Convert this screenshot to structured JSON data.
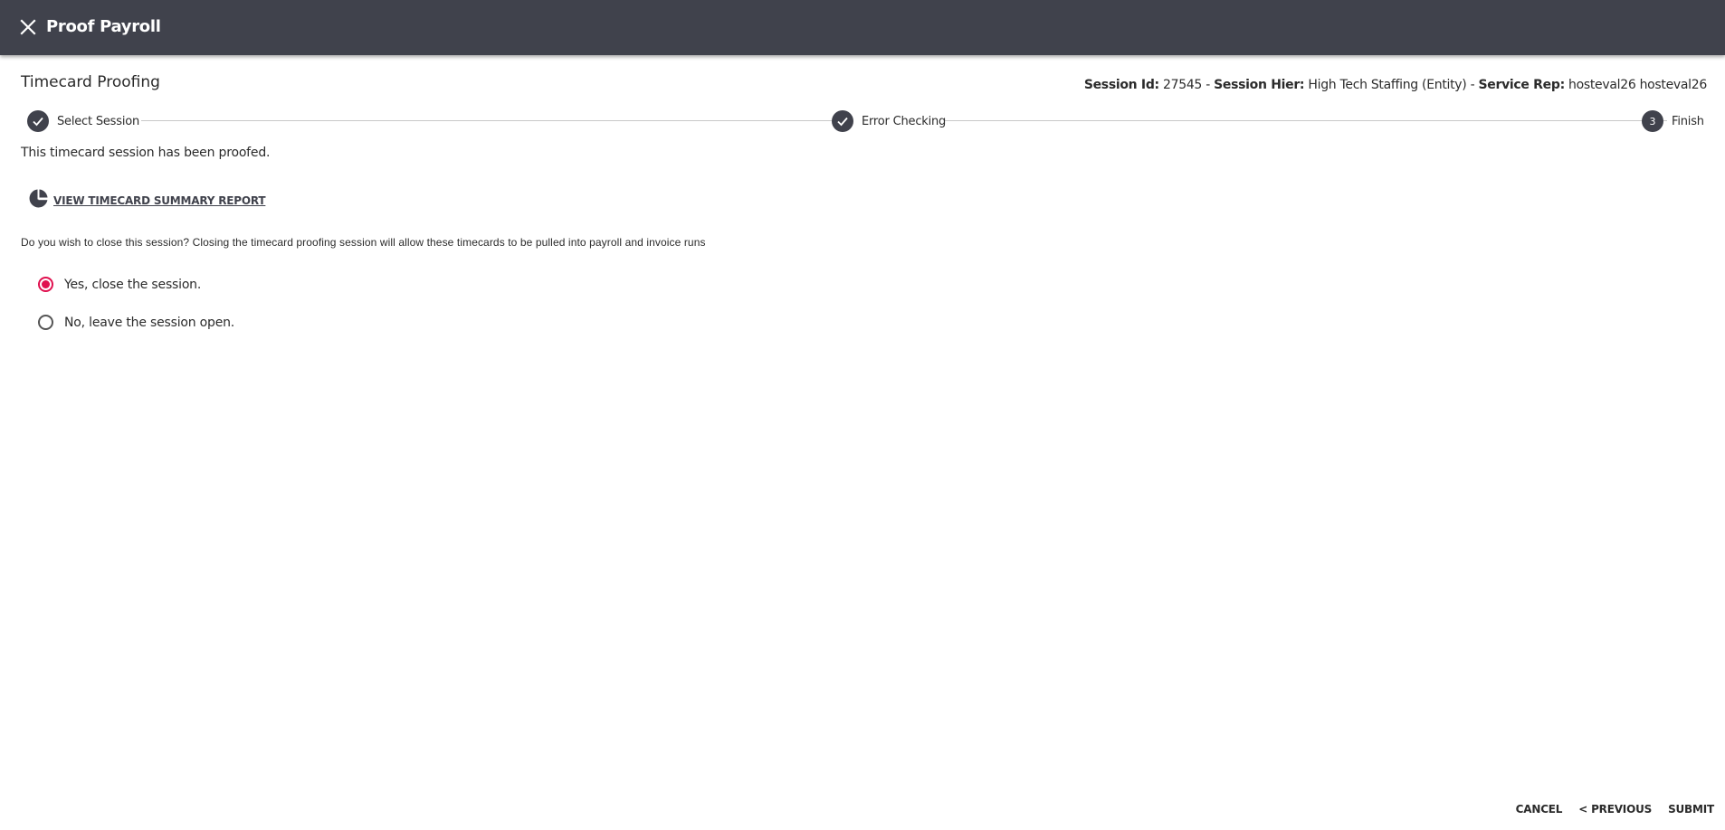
{
  "header": {
    "title": "Proof Payroll",
    "close_icon": "close-icon"
  },
  "page": {
    "title": "Timecard Proofing"
  },
  "session": {
    "id_label": "Session Id:",
    "id_value": "27545",
    "sep1": " - ",
    "hier_label": "Session Hier:",
    "hier_value": "High Tech Staffing (Entity)",
    "sep2": " - ",
    "rep_label": "Service Rep:",
    "rep_value": "hosteval26 hosteval26"
  },
  "stepper": {
    "steps": [
      {
        "label": "Select Session",
        "state": "complete",
        "icon": "check-icon"
      },
      {
        "label": "Error Checking",
        "state": "complete",
        "icon": "check-icon"
      },
      {
        "label": "Finish",
        "state": "active",
        "number": "3"
      }
    ]
  },
  "content": {
    "proofed_message": "This timecard session has been proofed.",
    "report_link_label": "VIEW TIMECARD SUMMARY REPORT",
    "report_icon": "pie-chart-icon",
    "close_question": "Do you wish to close this session? Closing the timecard proofing session will allow these timecards to be pulled into payroll and invoice runs",
    "options": [
      {
        "label": "Yes, close the session.",
        "checked": true
      },
      {
        "label": "No, leave the session open.",
        "checked": false
      }
    ]
  },
  "footer": {
    "cancel_label": "CANCEL",
    "previous_label": "< PREVIOUS",
    "submit_label": "SUBMIT"
  },
  "colors": {
    "header_bg": "#40424c",
    "accent": "#e0114f",
    "step_circle": "#40424c"
  }
}
